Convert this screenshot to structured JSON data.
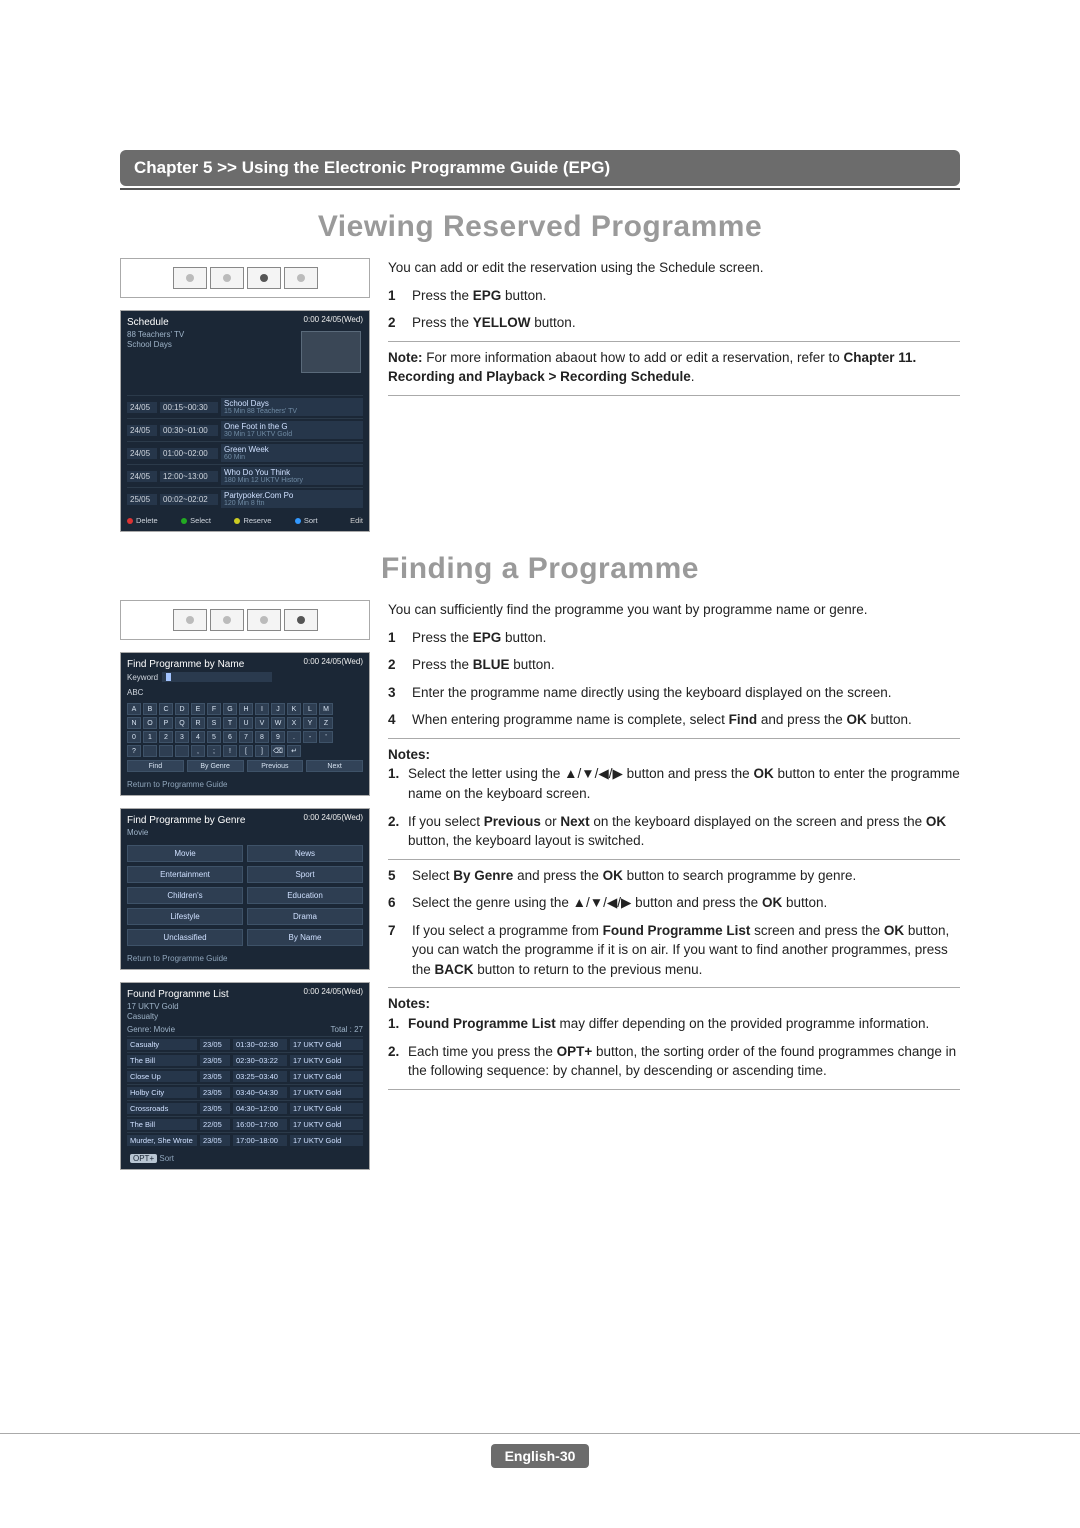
{
  "chapter_bar": "Chapter 5 >> Using the Electronic Programme Guide (EPG)",
  "section1": {
    "title": "Viewing Reserved Programme",
    "intro": "You can add or edit the reservation using the Schedule screen.",
    "steps": [
      {
        "n": "1",
        "pre": "Press the ",
        "bold": "EPG",
        "post": " button."
      },
      {
        "n": "2",
        "pre": "Press the ",
        "bold": "YELLOW",
        "post": " button."
      }
    ],
    "note_pre": "Note:",
    "note_text": " For more information abaout how to add or edit a reservation, refer to ",
    "note_bold": "Chapter 11. Recording and Playback > Recording Schedule",
    "note_end": "."
  },
  "section2": {
    "title": "Finding a Programme",
    "intro": "You can sufficiently find the programme you want by programme name or genre.",
    "steps_a": [
      {
        "n": "1",
        "pre": "Press the ",
        "bold": "EPG",
        "post": " button."
      },
      {
        "n": "2",
        "pre": "Press the ",
        "bold": "BLUE",
        "post": " button."
      },
      {
        "n": "3",
        "pre": "",
        "bold": "",
        "post": "Enter the programme name directly using the keyboard displayed on the screen."
      },
      {
        "n": "4",
        "pre": "When entering programme name is complete, select ",
        "bold": "Find",
        "post": " and press the ",
        "bold2": "OK",
        "post2": " button."
      }
    ],
    "notes_a_label": "Notes:",
    "notes_a": [
      {
        "n": "1.",
        "text_pre": "Select the letter using the ▲/▼/◀/▶ button and press the ",
        "b1": "OK",
        "text_post": " button to enter the programme name on the keyboard screen."
      },
      {
        "n": "2.",
        "text_pre": "If you select ",
        "b1": "Previous",
        "mid": " or ",
        "b2": "Next",
        "text_post": " on the keyboard displayed on the screen and press the ",
        "b3": "OK",
        "text_end": " button, the keyboard layout is switched."
      }
    ],
    "steps_b": [
      {
        "n": "5",
        "pre": "Select ",
        "bold": "By Genre",
        "post": " and press the ",
        "bold2": "OK",
        "post2": " button to search programme by genre."
      },
      {
        "n": "6",
        "pre": "Select the genre using the ▲/▼/◀/▶ button and press the ",
        "bold": "OK",
        "post": " button.",
        "bold2": "",
        "post2": ""
      },
      {
        "n": "7",
        "pre": "If you select a programme from ",
        "bold": "Found Programme List",
        "post": " screen and press the ",
        "bold2": "OK",
        "post2": " button, you can watch the programme if it is on air. If you want to find another programmes, press the ",
        "bold3": "BACK",
        "post3": " button to return to the previous menu."
      }
    ],
    "notes_b_label": "Notes:",
    "notes_b": [
      {
        "n": "1.",
        "b1": "Found Programme List",
        "text_post": " may differ depending on the provided programme information."
      },
      {
        "n": "2.",
        "text_pre": "Each time you press the ",
        "b1": "OPT+",
        "text_post": " button, the sorting order of the found programmes change in the following sequence: by channel, by descending or ascending time."
      }
    ]
  },
  "footer_label": "English-30",
  "shots": {
    "clock": "0:00 24/05(Wed)",
    "schedule": {
      "title": "Schedule",
      "sub1": "88 Teachers' TV",
      "sub2": "School Days",
      "rows": [
        {
          "date": "24/05",
          "time": "00:15~00:30",
          "prog": "School Days",
          "chan": "88 Teachers' TV",
          "mins": "15 Min"
        },
        {
          "date": "24/05",
          "time": "00:30~01:00",
          "prog": "One Foot in the G",
          "chan": "17 UKTV Gold",
          "mins": "30 Min"
        },
        {
          "date": "24/05",
          "time": "01:00~02:00",
          "prog": "Green Week",
          "chan": "",
          "mins": "60 Min"
        },
        {
          "date": "24/05",
          "time": "12:00~13:00",
          "prog": "Who Do You Think",
          "chan": "12 UKTV History",
          "mins": "180 Min"
        },
        {
          "date": "25/05",
          "time": "00:02~02:02",
          "prog": "Partypoker.Com Po",
          "chan": "8 ftn",
          "mins": "120 Min"
        }
      ],
      "actions": {
        "red": "Delete",
        "green": "Select",
        "yellow": "Reserve",
        "blue": "Sort",
        "ok": "Edit"
      }
    },
    "findName": {
      "title": "Find Programme by Name",
      "keyword_label": "Keyword",
      "abc": "ABC",
      "keys_r1": [
        "A",
        "B",
        "C",
        "D",
        "E",
        "F",
        "G",
        "H",
        "I",
        "J",
        "K",
        "L",
        "M"
      ],
      "keys_r2": [
        "N",
        "O",
        "P",
        "Q",
        "R",
        "S",
        "T",
        "U",
        "V",
        "W",
        "X",
        "Y",
        "Z"
      ],
      "keys_r3": [
        "0",
        "1",
        "2",
        "3",
        "4",
        "5",
        "6",
        "7",
        "8",
        "9",
        ".",
        "-",
        "'"
      ],
      "keys_r4": [
        "?",
        " ",
        " ",
        " ",
        ",",
        ";",
        "!",
        "[",
        "]",
        "⌫",
        "↵"
      ],
      "funcs": [
        "Find",
        "By Genre",
        "Previous",
        "Next"
      ],
      "return": "Return to Programme Guide"
    },
    "findGenre": {
      "title": "Find Programme by Genre",
      "current": "Movie",
      "cells": [
        "Movie",
        "News",
        "Entertainment",
        "Sport",
        "Children's",
        "Education",
        "Lifestyle",
        "Drama",
        "Unclassified",
        "By Name"
      ],
      "return": "Return to Programme Guide"
    },
    "foundList": {
      "title": "Found Programme List",
      "chan_now": "17 UKTV Gold",
      "prog_now": "Casualty",
      "genre_label": "Genre: Movie",
      "total_label": "Total : 27",
      "rows": [
        {
          "name": "Casualty",
          "date": "23/05",
          "time": "01:30~02:30",
          "chan": "17 UKTV Gold"
        },
        {
          "name": "The Bill",
          "date": "23/05",
          "time": "02:30~03:22",
          "chan": "17 UKTV Gold"
        },
        {
          "name": "Close Up",
          "date": "23/05",
          "time": "03:25~03:40",
          "chan": "17 UKTV Gold"
        },
        {
          "name": "Holby City",
          "date": "23/05",
          "time": "03:40~04:30",
          "chan": "17 UKTV Gold"
        },
        {
          "name": "Crossroads",
          "date": "23/05",
          "time": "04:30~12:00",
          "chan": "17 UKTV Gold"
        },
        {
          "name": "The Bill",
          "date": "22/05",
          "time": "16:00~17:00",
          "chan": "17 UKTV Gold"
        },
        {
          "name": "Murder, She Wrote",
          "date": "23/05",
          "time": "17:00~18:00",
          "chan": "17 UKTV Gold"
        }
      ],
      "opt_label": "Sort",
      "opt_key": "OPT+"
    }
  }
}
